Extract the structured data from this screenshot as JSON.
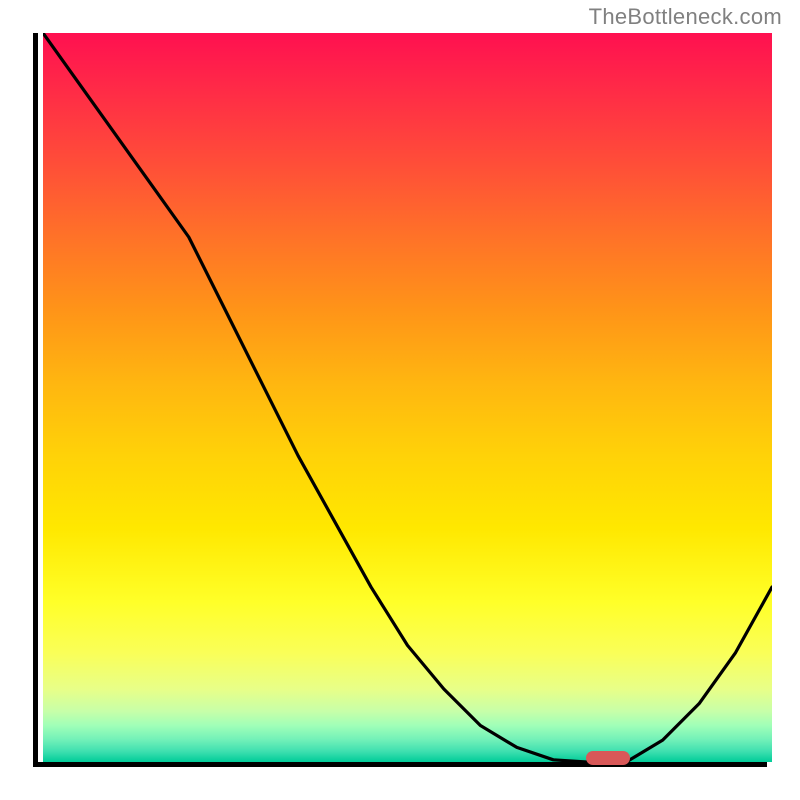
{
  "watermark": "TheBottleneck.com",
  "colors": {
    "axis": "#000000",
    "curve": "#000000",
    "marker": "#d85858",
    "watermark": "#808080"
  },
  "chart_data": {
    "type": "line",
    "title": "",
    "xlabel": "",
    "ylabel": "",
    "x": [
      0.0,
      0.05,
      0.1,
      0.15,
      0.2,
      0.25,
      0.3,
      0.35,
      0.4,
      0.45,
      0.5,
      0.55,
      0.6,
      0.65,
      0.7,
      0.745,
      0.8,
      0.85,
      0.9,
      0.95,
      1.0
    ],
    "values": [
      1.0,
      0.93,
      0.86,
      0.79,
      0.72,
      0.62,
      0.52,
      0.42,
      0.33,
      0.24,
      0.16,
      0.1,
      0.05,
      0.02,
      0.003,
      0.0,
      0.0,
      0.03,
      0.08,
      0.15,
      0.24
    ],
    "xlim": [
      0,
      1
    ],
    "ylim": [
      0,
      1
    ],
    "notes": "Black curve overlaid on red-to-green vertical gradient background. Axes are unlabeled. A small horizontal pill-shaped marker sits at the curve minimum near x approx 0.74 to 0.80, y approx 0.",
    "gradient_stops": [
      {
        "pct": 0,
        "color": "#ff1050"
      },
      {
        "pct": 18,
        "color": "#ff4e38"
      },
      {
        "pct": 38,
        "color": "#ff9418"
      },
      {
        "pct": 58,
        "color": "#ffd208"
      },
      {
        "pct": 78,
        "color": "#ffff28"
      },
      {
        "pct": 90,
        "color": "#e8ff88"
      },
      {
        "pct": 97,
        "color": "#70f0b8"
      },
      {
        "pct": 100,
        "color": "#00cc99"
      }
    ],
    "marker": {
      "x_start": 0.745,
      "x_end": 0.805,
      "y": 0.003
    }
  }
}
